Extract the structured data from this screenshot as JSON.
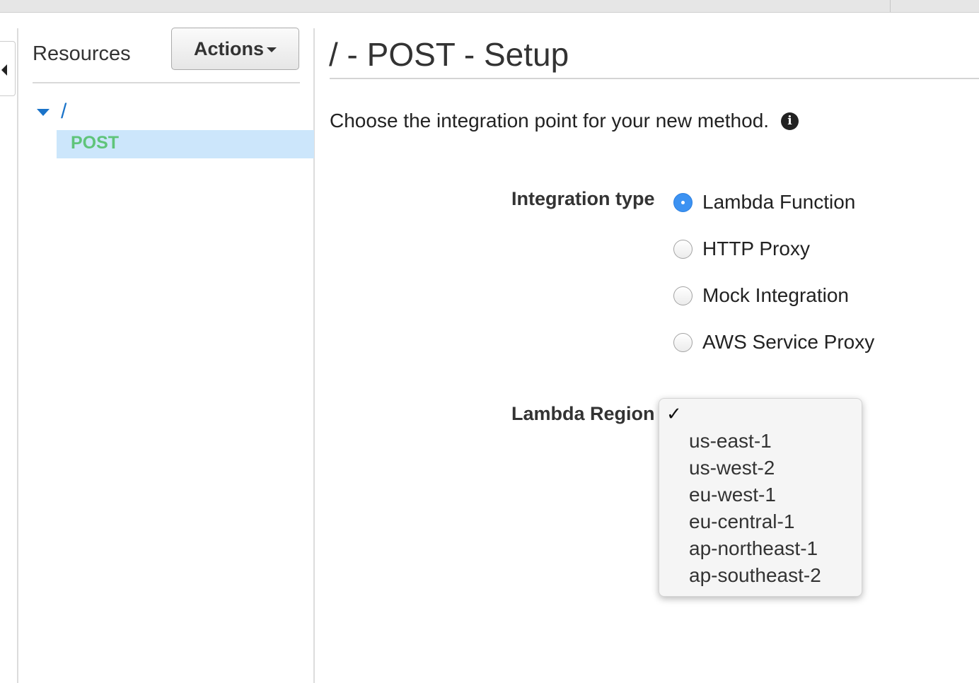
{
  "sidebar": {
    "title": "Resources",
    "actions_label": "Actions",
    "tree": {
      "root": "/",
      "method": "POST"
    }
  },
  "main": {
    "title": "/ - POST - Setup",
    "intro": "Choose the integration point for your new method.",
    "integration_type_label": "Integration type",
    "integration_options": [
      "Lambda Function",
      "HTTP Proxy",
      "Mock Integration",
      "AWS Service Proxy"
    ],
    "selected_integration": "Lambda Function",
    "lambda_region_label": "Lambda Region",
    "region_selected": "",
    "region_options": [
      "us-east-1",
      "us-west-2",
      "eu-west-1",
      "eu-central-1",
      "ap-northeast-1",
      "ap-southeast-2"
    ]
  },
  "icons": {
    "collapse": "triangle-left-icon",
    "tree_expand": "caret-down-icon",
    "info": "info-icon",
    "check": "checkmark-icon",
    "actions_caret": "caret-down-icon"
  },
  "colors": {
    "link_blue": "#1a73c9",
    "post_green": "#5fc47a",
    "selected_row": "#cce6fb",
    "radio_checked": "#3c92f2"
  }
}
